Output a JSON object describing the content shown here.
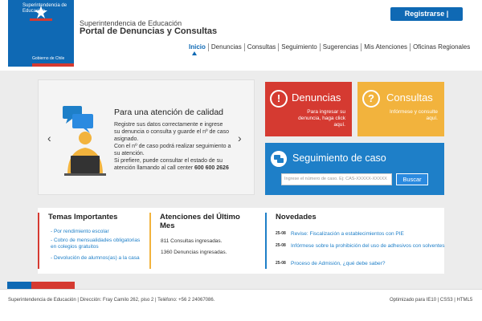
{
  "header": {
    "logo_top": "Superintendencia de Educación",
    "logo_bottom": "Gobierno de Chile",
    "site_subtitle": "Superintendencia de Educación",
    "site_title": "Portal de Denuncias y Consultas",
    "register_label": "Registrarse |"
  },
  "nav": {
    "items": [
      "Inicio",
      "Denuncias",
      "Consultas",
      "Seguimiento",
      "Sugerencias",
      "Mis Atenciones",
      "Oficinas Regionales"
    ]
  },
  "carousel": {
    "title": "Para una atención de calidad",
    "lines": [
      "Registre sus datos correctamente e ingrese",
      "su denuncia o consulta y guarde el nº de caso",
      "asignado.",
      "Con el nº de caso podrá realizar seguimiento a",
      "su atención.",
      "Si prefiere, puede consultar el estado de su"
    ],
    "last_line_prefix": "atención llamando al call center ",
    "phone": "600 600 2626",
    "prev": "‹",
    "next": "›"
  },
  "tiles": {
    "denuncias": {
      "icon": "!",
      "title": "Denuncias",
      "desc_1": "Para ingresar su",
      "desc_2": "denuncia, haga click",
      "desc_3": "aquí."
    },
    "consultas": {
      "icon": "?",
      "title": "Consultas",
      "desc_1": "Infórmese y consulte",
      "desc_2": "aquí."
    },
    "seguimiento": {
      "title": "Seguimiento de caso",
      "placeholder": "Ingrese el número de caso. Ej: CAS-XXXXX-XXXXX",
      "button": "Buscar"
    }
  },
  "temas": {
    "title": "Temas Importantes",
    "links": [
      "- Por rendimiento escolar",
      "- Cobro de mensualidades obligatorias en colegios gratuitos",
      "- Devolución de alumnos(as) a la casa"
    ]
  },
  "atenciones": {
    "title": "Atenciones del Último Mes",
    "lines": [
      "811 Consultas ingresadas.",
      "1360 Denuncias ingresadas."
    ]
  },
  "novedades": {
    "title": "Novedades",
    "items": [
      {
        "date": "25-08",
        "text": "Revise: Fiscalización a establecimientos con PIE"
      },
      {
        "date": "25-08",
        "text": "Infórmese sobre la prohibición del uso de adhesivos con solventes"
      },
      {
        "date": "25-08",
        "text": "Proceso de Admisión, ¿qué debe saber?"
      }
    ]
  },
  "footer": {
    "text": "Superintendencia de Educación | Dirección: Fray Camilo 262, piso 2 | Teléfono: +56 2 24067086.",
    "right": "Optimizado para IE10   |   CSS3  |  HTML5"
  },
  "colors": {
    "brand_blue": "#0f69b4",
    "red": "#d53a31",
    "yellow": "#f2b33d",
    "blue": "#1e7fc8"
  }
}
